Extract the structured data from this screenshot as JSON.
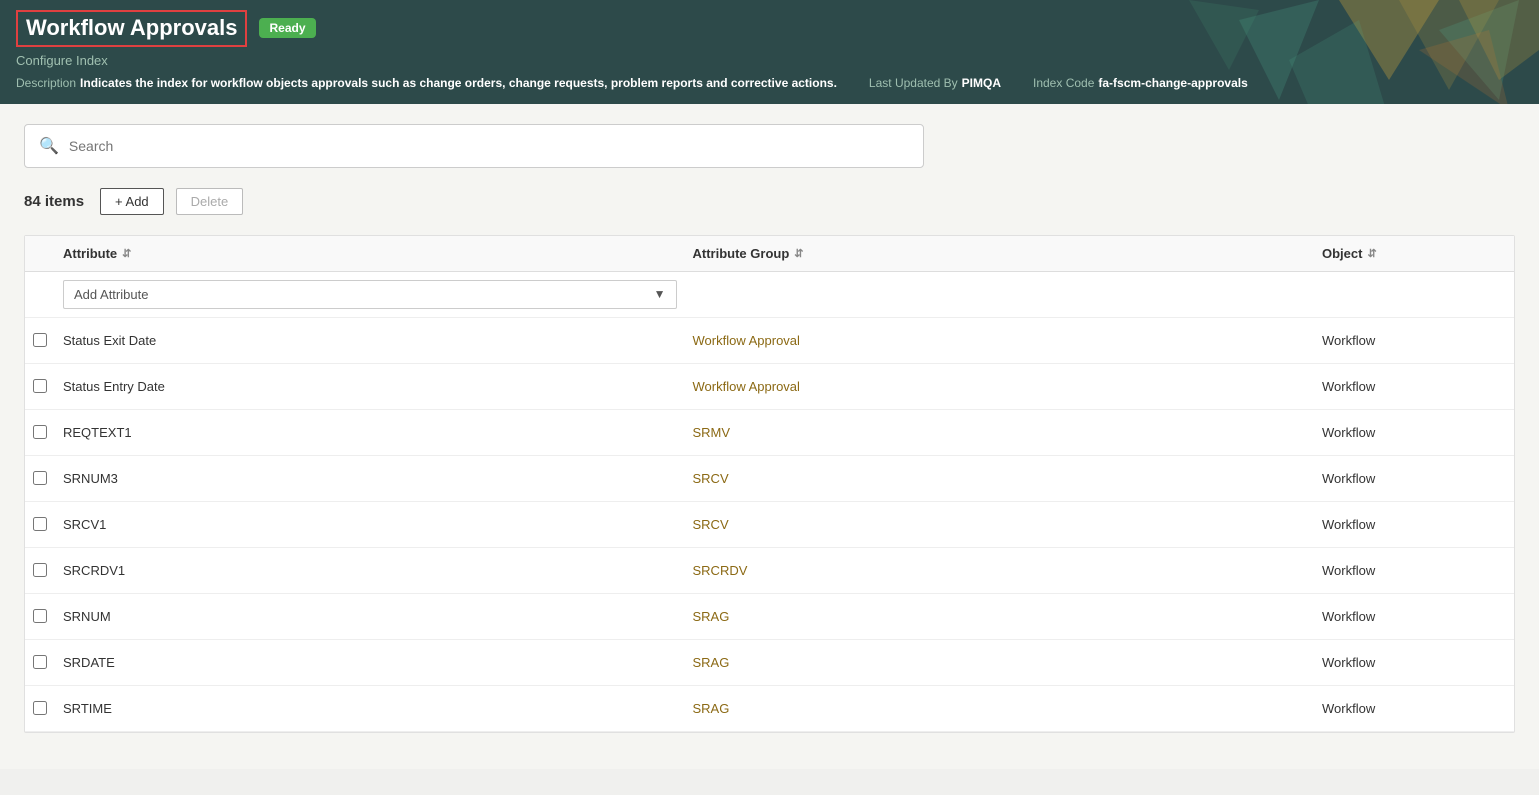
{
  "header": {
    "title": "Workflow Approvals",
    "ready_badge": "Ready",
    "configure_index": "Configure Index",
    "description_label": "Description",
    "description_value": "Indicates the index for workflow objects approvals such as change orders, change requests, problem reports and corrective actions.",
    "last_updated_label": "Last Updated By",
    "last_updated_value": "PIMQA",
    "index_code_label": "Index Code",
    "index_code_value": "fa-fscm-change-approvals"
  },
  "search": {
    "placeholder": "Search"
  },
  "toolbar": {
    "items_count": "84 items",
    "add_label": "+ Add",
    "delete_label": "Delete"
  },
  "table": {
    "columns": [
      {
        "label": "Attribute",
        "sort": true
      },
      {
        "label": "Attribute Group",
        "sort": true
      },
      {
        "label": "Object",
        "sort": true
      }
    ],
    "add_attribute_placeholder": "Add Attribute",
    "rows": [
      {
        "attribute": "Status Exit Date",
        "attribute_group": "Workflow Approval",
        "object": "Workflow"
      },
      {
        "attribute": "Status Entry Date",
        "attribute_group": "Workflow Approval",
        "object": "Workflow"
      },
      {
        "attribute": "REQTEXT1",
        "attribute_group": "SRMV",
        "object": "Workflow"
      },
      {
        "attribute": "SRNUM3",
        "attribute_group": "SRCV",
        "object": "Workflow"
      },
      {
        "attribute": "SRCV1",
        "attribute_group": "SRCV",
        "object": "Workflow"
      },
      {
        "attribute": "SRCRDV1",
        "attribute_group": "SRCRDV",
        "object": "Workflow"
      },
      {
        "attribute": "SRNUM",
        "attribute_group": "SRAG",
        "object": "Workflow"
      },
      {
        "attribute": "SRDATE",
        "attribute_group": "SRAG",
        "object": "Workflow"
      },
      {
        "attribute": "SRTIME",
        "attribute_group": "SRAG",
        "object": "Workflow"
      }
    ]
  }
}
